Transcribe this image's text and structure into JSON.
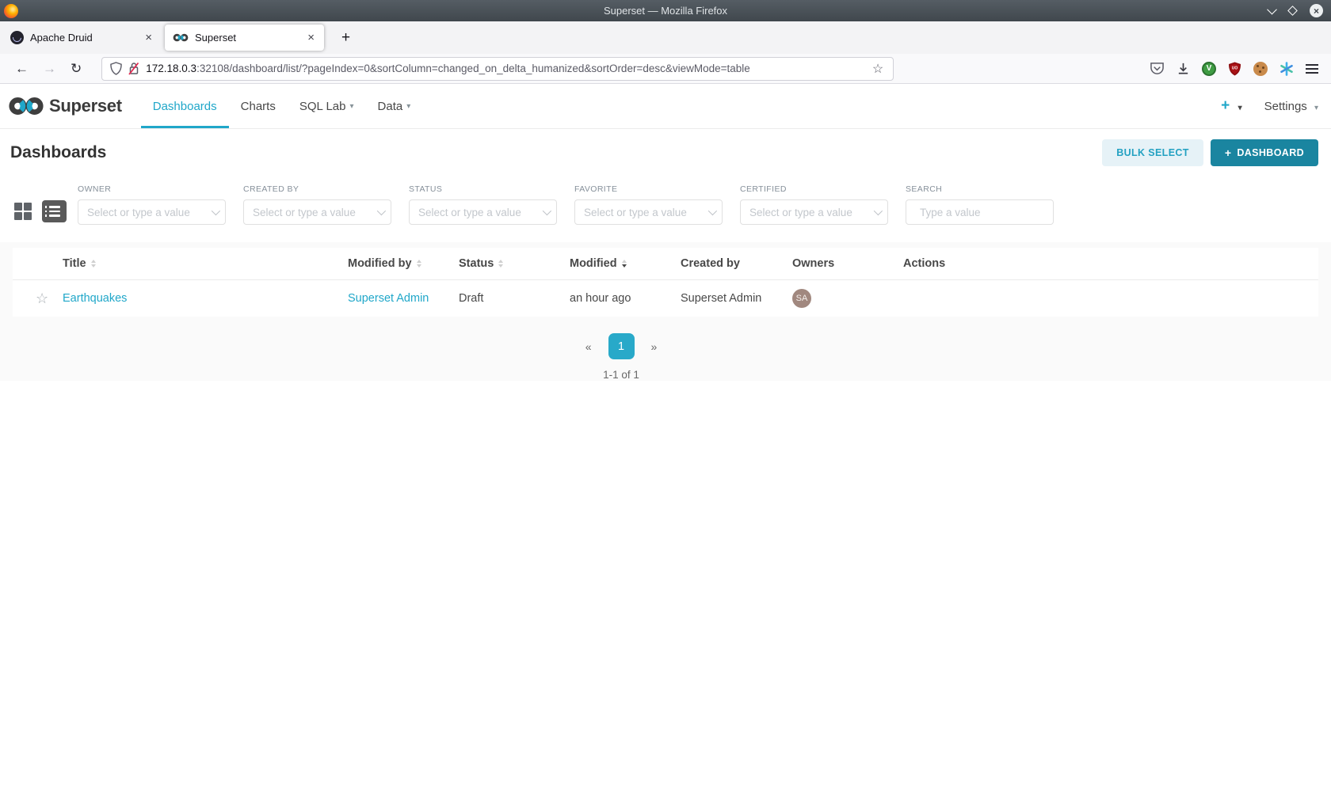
{
  "window": {
    "title": "Superset — Mozilla Firefox",
    "tabs": [
      {
        "label": "Apache Druid"
      },
      {
        "label": "Superset"
      }
    ],
    "close_glyph": "×",
    "new_tab_glyph": "+"
  },
  "browser": {
    "back_glyph": "←",
    "forward_glyph": "→",
    "reload_glyph": "↻",
    "url_host": "172.18.0.3",
    "url_rest": ":32108/dashboard/list/?pageIndex=0&sortColumn=changed_on_delta_humanized&sortOrder=desc&viewMode=table",
    "bookmark_glyph": "☆",
    "green_ext_glyph": "V"
  },
  "navbar": {
    "brand": "Superset",
    "items": [
      {
        "label": "Dashboards"
      },
      {
        "label": "Charts"
      },
      {
        "label": "SQL Lab"
      },
      {
        "label": "Data"
      }
    ],
    "caret": "▾",
    "plus": "+",
    "settings": "Settings"
  },
  "page": {
    "title": "Dashboards",
    "bulk_select_label": "BULK SELECT",
    "new_dashboard_plus": "+",
    "new_dashboard_label": "DASHBOARD"
  },
  "filters": {
    "owner": {
      "label": "OWNER",
      "placeholder": "Select or type a value"
    },
    "created_by": {
      "label": "CREATED BY",
      "placeholder": "Select or type a value"
    },
    "status": {
      "label": "STATUS",
      "placeholder": "Select or type a value"
    },
    "favorite": {
      "label": "FAVORITE",
      "placeholder": "Select or type a value"
    },
    "certified": {
      "label": "CERTIFIED",
      "placeholder": "Select or type a value"
    },
    "search": {
      "label": "SEARCH",
      "placeholder": "Type a value"
    }
  },
  "table": {
    "columns": [
      {
        "label": "Title"
      },
      {
        "label": "Modified by"
      },
      {
        "label": "Status"
      },
      {
        "label": "Modified"
      },
      {
        "label": "Created by"
      },
      {
        "label": "Owners"
      },
      {
        "label": "Actions"
      }
    ],
    "row": {
      "favorite_glyph": "☆",
      "title": "Earthquakes",
      "modified_by": "Superset Admin",
      "status": "Draft",
      "modified": "an hour ago",
      "created_by": "Superset Admin",
      "owner_initials": "SA"
    }
  },
  "pagination": {
    "prev": "«",
    "page": "1",
    "next": "»",
    "summary": "1-1 of 1"
  },
  "colors": {
    "accent": "#20a7c9",
    "primary_button": "#1a85a0",
    "avatar": "#a1887f",
    "titlebar": "#4c545b"
  }
}
